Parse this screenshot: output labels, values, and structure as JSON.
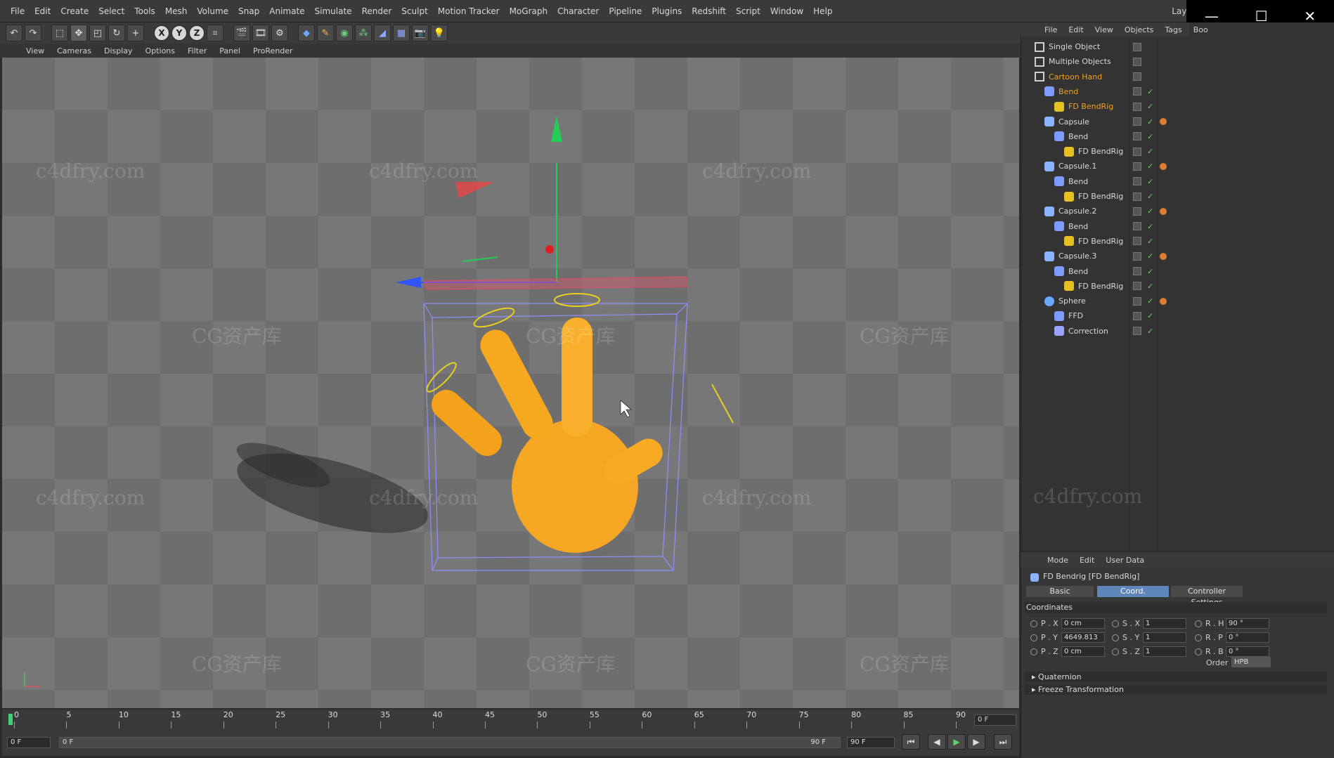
{
  "menubar": {
    "items": [
      "File",
      "Edit",
      "Create",
      "Select",
      "Tools",
      "Mesh",
      "Volume",
      "Snap",
      "Animate",
      "Simulate",
      "Render",
      "Sculpt",
      "Motion Tracker",
      "MoGraph",
      "Character",
      "Pipeline",
      "Plugins",
      "Redshift",
      "Script",
      "Window",
      "Help"
    ],
    "layout_label": "Layout"
  },
  "toolbar": {
    "undo": "↶",
    "redo": "↷",
    "select": "⬚",
    "move": "✥",
    "scale": "◰",
    "rotate": "↻",
    "add": "+",
    "axis_x": "X",
    "axis_y": "Y",
    "axis_z": "Z",
    "coord": "⌗"
  },
  "viewport_menu": {
    "items": [
      "View",
      "Cameras",
      "Display",
      "Options",
      "Filter",
      "Panel",
      "ProRender"
    ]
  },
  "watermarks": {
    "site": "c4dfry.com",
    "brand": "CG资产库"
  },
  "timeline": {
    "labels": [
      "0",
      "5",
      "10",
      "15",
      "20",
      "25",
      "30",
      "35",
      "40",
      "45",
      "50",
      "55",
      "60",
      "65",
      "70",
      "75",
      "80",
      "85",
      "90"
    ],
    "current_frame": "0 F",
    "start_field": "0 F",
    "range_start": "0 F",
    "range_end": "90 F",
    "end_field": "90 F"
  },
  "playback": {
    "first": "⏮",
    "prev": "◀",
    "play": "▶",
    "next": "▶",
    "last": "⏭"
  },
  "objects_panel": {
    "menu": [
      "File",
      "Edit",
      "View",
      "Objects",
      "Tags",
      "Boo"
    ],
    "items": [
      {
        "name": "Single Object",
        "indent": 0,
        "type": "null",
        "highlight": false
      },
      {
        "name": "Multiple Objects",
        "indent": 0,
        "type": "null",
        "highlight": false
      },
      {
        "name": "Cartoon Hand",
        "indent": 0,
        "type": "null",
        "highlight": true
      },
      {
        "name": "Bend",
        "indent": 1,
        "type": "bend",
        "highlight": true
      },
      {
        "name": "FD BendRig",
        "indent": 2,
        "type": "rig",
        "highlight": true
      },
      {
        "name": "Capsule",
        "indent": 1,
        "type": "capsule",
        "highlight": false
      },
      {
        "name": "Bend",
        "indent": 2,
        "type": "bend",
        "highlight": false
      },
      {
        "name": "FD BendRig",
        "indent": 3,
        "type": "rig",
        "highlight": false
      },
      {
        "name": "Capsule.1",
        "indent": 1,
        "type": "capsule",
        "highlight": false
      },
      {
        "name": "Bend",
        "indent": 2,
        "type": "bend",
        "highlight": false
      },
      {
        "name": "FD BendRig",
        "indent": 3,
        "type": "rig",
        "highlight": false
      },
      {
        "name": "Capsule.2",
        "indent": 1,
        "type": "capsule",
        "highlight": false
      },
      {
        "name": "Bend",
        "indent": 2,
        "type": "bend",
        "highlight": false
      },
      {
        "name": "FD BendRig",
        "indent": 3,
        "type": "rig",
        "highlight": false
      },
      {
        "name": "Capsule.3",
        "indent": 1,
        "type": "capsule",
        "highlight": false
      },
      {
        "name": "Bend",
        "indent": 2,
        "type": "bend",
        "highlight": false
      },
      {
        "name": "FD BendRig",
        "indent": 3,
        "type": "rig",
        "highlight": false
      },
      {
        "name": "Sphere",
        "indent": 1,
        "type": "sphere",
        "highlight": false
      },
      {
        "name": "FFD",
        "indent": 2,
        "type": "ffd",
        "highlight": false
      },
      {
        "name": "Correction",
        "indent": 2,
        "type": "correction",
        "highlight": false
      }
    ]
  },
  "attributes": {
    "menu": [
      "Mode",
      "Edit",
      "User Data"
    ],
    "title": "FD Bendrig [FD BendRig]",
    "tabs": [
      "Basic",
      "Coord.",
      "Controller Settings"
    ],
    "active_tab": "Coord.",
    "section": "Coordinates",
    "rows": [
      {
        "p_label": "P . X",
        "p_val": "0 cm",
        "s_label": "S . X",
        "s_val": "1",
        "r_label": "R . H",
        "r_val": "90 °"
      },
      {
        "p_label": "P . Y",
        "p_val": "4649.813",
        "s_label": "S . Y",
        "s_val": "1",
        "r_label": "R . P",
        "r_val": "0 °"
      },
      {
        "p_label": "P . Z",
        "p_val": "0 cm",
        "s_label": "S . Z",
        "s_val": "1",
        "r_label": "R . B",
        "r_val": "0 °"
      }
    ],
    "order_label": "Order",
    "order_value": "HPB",
    "groups": [
      "Quaternion",
      "Freeze Transformation"
    ]
  },
  "colors": {
    "accent_blue": "#5f86b8",
    "highlight_orange": "#f0a020",
    "hand": "#f5a623"
  }
}
